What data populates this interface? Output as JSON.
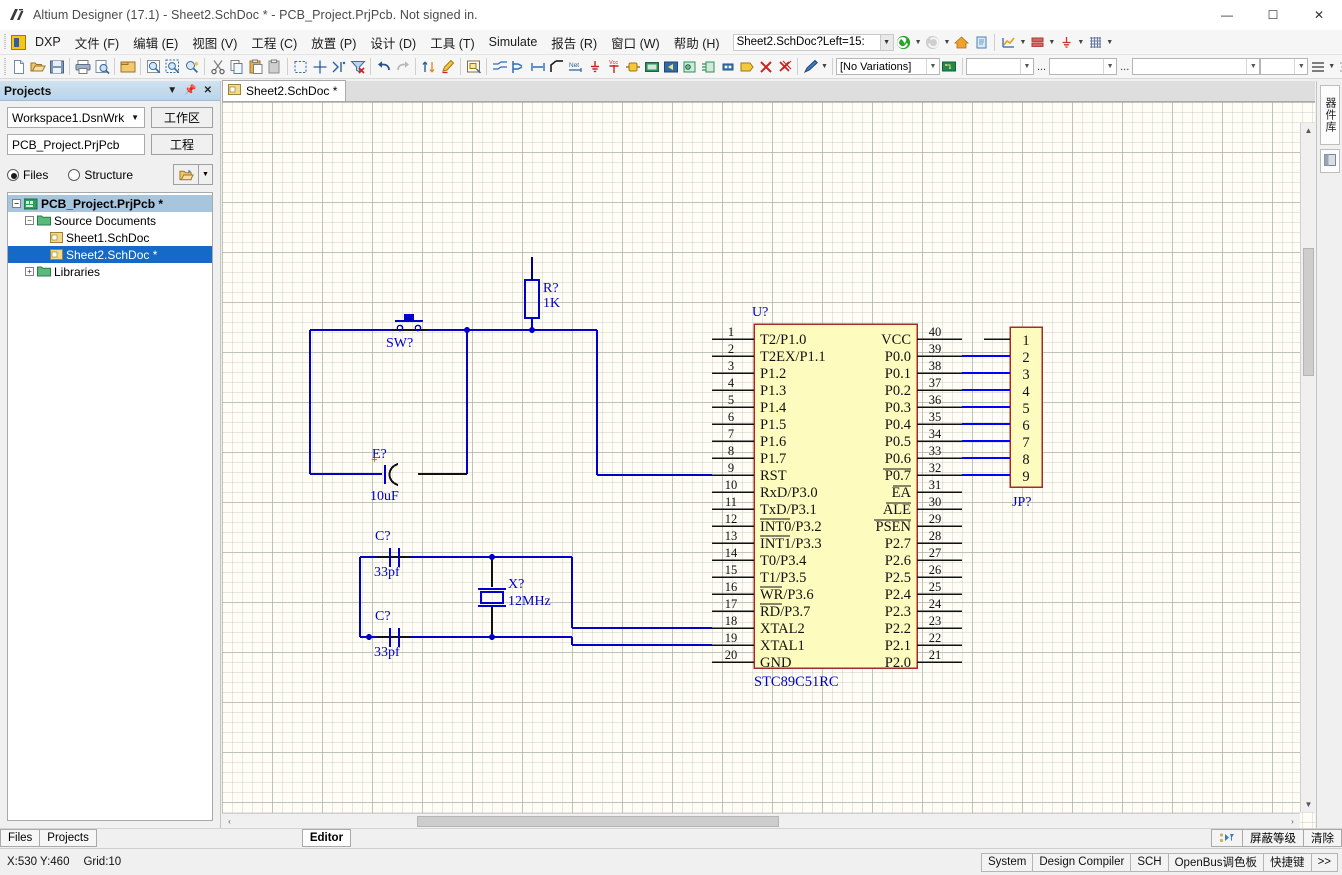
{
  "window": {
    "title": "Altium Designer (17.1) - Sheet2.SchDoc * - PCB_Project.PrjPcb. Not signed in.",
    "minimize": "—",
    "maximize": "☐",
    "close": "✕",
    "app_icon": "altium-logo-icon"
  },
  "menubar": {
    "dxp": "DXP",
    "items": [
      {
        "label": "文件 (F)"
      },
      {
        "label": "编辑 (E)"
      },
      {
        "label": "视图 (V)"
      },
      {
        "label": "工程 (C)"
      },
      {
        "label": "放置 (P)"
      },
      {
        "label": "设计 (D)"
      },
      {
        "label": "工具 (T)"
      },
      {
        "label": "Simulate"
      },
      {
        "label": "报告 (R)"
      },
      {
        "label": "窗口 (W)"
      },
      {
        "label": "帮助 (H)"
      }
    ],
    "address_value": "Sheet2.SchDoc?Left=15:",
    "nav_icons": [
      "back-icon",
      "forward-icon",
      "home-icon",
      "page-icon",
      "chart-icon",
      "layers-icon",
      "ground-icon",
      "grid-icon"
    ]
  },
  "toolbar": {
    "groups": [
      [
        "new-document-icon",
        "open-document-icon",
        "save-document-icon"
      ],
      [
        "print-icon",
        "print-preview-icon"
      ],
      [
        "open-project-icon"
      ],
      [
        "zoom-area-icon",
        "zoom-selected-icon",
        "zoom-cursor-icon"
      ],
      [
        "cut-icon",
        "copy-icon",
        "paste-icon",
        "rubber-stamp-icon"
      ],
      [
        "select-area-icon",
        "move-icon",
        "deselect-icon",
        "clear-filter-icon"
      ],
      [
        "undo-icon",
        "redo-icon"
      ],
      [
        "hierarchy-icon",
        "annotate-icon"
      ],
      [
        "browse-component-icon"
      ],
      [
        "place-wire-icon",
        "place-bus-icon",
        "place-bus-entry-icon",
        "place-signal-harness-icon",
        "place-netlabel-icon",
        "place-gnd-icon",
        "place-vcc-icon",
        "place-part-icon",
        "place-sheet-symbol-icon",
        "place-sheet-entry-icon",
        "place-device-sheet-icon",
        "place-harness-connector-icon",
        "place-port-icon",
        "place-no-erc-icon",
        "delete-no-erc-icon",
        "delete-all-no-erc-icon"
      ],
      [
        "draw-line-icon"
      ]
    ],
    "variations_value": "[No Variations]",
    "variations_icon": "pcb-board-icon",
    "combo1_value": "",
    "combo2_value": "",
    "combo3_value": "",
    "combo4_value": "",
    "ellipsis": "...",
    "align_icons": [
      "align-left-icon",
      "align-distribute-icon",
      "align-spacing-icon"
    ]
  },
  "projects_panel": {
    "title": "Projects",
    "header_buttons": [
      "dropdown-menu-icon",
      "pin-icon",
      "close-icon"
    ],
    "workspace_value": "Workspace1.DsnWrk",
    "workspace_button": "工作区",
    "project_value": "PCB_Project.PrjPcb",
    "project_button": "工程",
    "view_mode": {
      "files_label": "Files",
      "structure_label": "Structure",
      "selected": "Files"
    },
    "open_button_icon": "open-folder-icon",
    "tree": [
      {
        "label": "PCB_Project.PrjPcb *",
        "indent": 0,
        "expander": "−",
        "icon": "project-icon",
        "state": "soft-selected"
      },
      {
        "label": "Source Documents",
        "indent": 1,
        "expander": "−",
        "icon": "folder-icon",
        "state": "normal"
      },
      {
        "label": "Sheet1.SchDoc",
        "indent": 2,
        "expander": "",
        "icon": "schematic-doc-icon",
        "state": "normal"
      },
      {
        "label": "Sheet2.SchDoc *",
        "indent": 2,
        "expander": "",
        "icon": "schematic-doc-icon",
        "state": "selected"
      },
      {
        "label": "Libraries",
        "indent": 1,
        "expander": "+",
        "icon": "folder-icon",
        "state": "normal"
      }
    ]
  },
  "editor": {
    "document_tab": "Sheet2.SchDoc *",
    "document_tab_icon": "schematic-doc-icon",
    "scroll_left_icon": "‹",
    "scroll_right_icon": "›",
    "scroll_up_icon": "▲",
    "scroll_down_icon": "▼"
  },
  "right_rail": {
    "tabs": [
      {
        "label": "器件库",
        "name": "component-library-tab"
      },
      {
        "label": "",
        "name": "panel-tab-2",
        "icon": "panel-icon"
      }
    ]
  },
  "bottom_tabs": {
    "left": [
      {
        "label": "Files",
        "active": false
      },
      {
        "label": "Projects",
        "active": false
      }
    ],
    "editor_tab": {
      "label": "Editor",
      "active": true
    },
    "right_buttons": [
      {
        "label": "",
        "icon": "mask-level-icon",
        "name": "mask-level-icon-button"
      },
      {
        "label": "屏蔽等级",
        "name": "mask-level-button"
      },
      {
        "label": "清除",
        "name": "clear-button"
      }
    ]
  },
  "statusbar": {
    "coordinates": "X:530 Y:460",
    "grid": "Grid:10",
    "panels": [
      {
        "label": "System"
      },
      {
        "label": "Design Compiler"
      },
      {
        "label": "SCH"
      },
      {
        "label": "OpenBus调色板"
      },
      {
        "label": "快捷键"
      },
      {
        "label": ">>"
      }
    ]
  },
  "schematic": {
    "colors": {
      "wire": "#0000c8",
      "pin_line": "#000000",
      "component_fill": "#fefbbe",
      "component_border": "#a52a2a",
      "designator": "#0000c8",
      "pin_label": "#000000",
      "net_blue": "#0000ff",
      "sheet_bg": "#fffdf6"
    },
    "components": [
      {
        "name": "microcontroller",
        "designator": "U?",
        "value": "STC89C51RC",
        "left_pins": [
          {
            "num": "1",
            "label": "T2/P1.0"
          },
          {
            "num": "2",
            "label": "T2EX/P1.1"
          },
          {
            "num": "3",
            "label": "P1.2"
          },
          {
            "num": "4",
            "label": "P1.3"
          },
          {
            "num": "5",
            "label": "P1.4"
          },
          {
            "num": "6",
            "label": "P1.5"
          },
          {
            "num": "7",
            "label": "P1.6"
          },
          {
            "num": "8",
            "label": "P1.7"
          },
          {
            "num": "9",
            "label": "RST"
          },
          {
            "num": "10",
            "label": "RxD/P3.0"
          },
          {
            "num": "11",
            "label": "TxD/P3.1"
          },
          {
            "num": "12",
            "label": "INT0/P3.2",
            "overbar": "INT0"
          },
          {
            "num": "13",
            "label": "INT1/P3.3",
            "overbar": "INT1"
          },
          {
            "num": "14",
            "label": "T0/P3.4"
          },
          {
            "num": "15",
            "label": "T1/P3.5"
          },
          {
            "num": "16",
            "label": "WR/P3.6",
            "overbar": "WR"
          },
          {
            "num": "17",
            "label": "RD/P3.7",
            "overbar": "RD"
          },
          {
            "num": "18",
            "label": "XTAL2"
          },
          {
            "num": "19",
            "label": "XTAL1"
          },
          {
            "num": "20",
            "label": "GND"
          }
        ],
        "right_pins": [
          {
            "num": "40",
            "label": "VCC"
          },
          {
            "num": "39",
            "label": "P0.0"
          },
          {
            "num": "38",
            "label": "P0.1"
          },
          {
            "num": "37",
            "label": "P0.2"
          },
          {
            "num": "36",
            "label": "P0.3"
          },
          {
            "num": "35",
            "label": "P0.4"
          },
          {
            "num": "34",
            "label": "P0.5"
          },
          {
            "num": "33",
            "label": "P0.6"
          },
          {
            "num": "32",
            "label": "P0.7",
            "overbar": "P0.7"
          },
          {
            "num": "31",
            "label": "EA",
            "overbar": "EA"
          },
          {
            "num": "30",
            "label": "ALE",
            "overbar": "ALE"
          },
          {
            "num": "29",
            "label": "PSEN",
            "overbar": "PSEN"
          },
          {
            "num": "28",
            "label": "P2.7"
          },
          {
            "num": "27",
            "label": "P2.6"
          },
          {
            "num": "26",
            "label": "P2.5"
          },
          {
            "num": "25",
            "label": "P2.4"
          },
          {
            "num": "24",
            "label": "P2.3"
          },
          {
            "num": "23",
            "label": "P2.2"
          },
          {
            "num": "22",
            "label": "P2.1"
          },
          {
            "num": "21",
            "label": "P2.0"
          }
        ]
      },
      {
        "name": "header-connector",
        "designator": "JP?",
        "pins": [
          "1",
          "2",
          "3",
          "4",
          "5",
          "6",
          "7",
          "8",
          "9"
        ]
      },
      {
        "name": "resistor",
        "designator": "R?",
        "value": "1K"
      },
      {
        "name": "push-button-switch",
        "designator": "SW?",
        "value": ""
      },
      {
        "name": "electrolytic-capacitor",
        "designator": "E?",
        "value": "10uF"
      },
      {
        "name": "capacitor-c1",
        "designator": "C?",
        "value": "33pf"
      },
      {
        "name": "capacitor-c2",
        "designator": "C?",
        "value": "33pf"
      },
      {
        "name": "crystal",
        "designator": "X?",
        "value": "12MHz"
      }
    ]
  }
}
